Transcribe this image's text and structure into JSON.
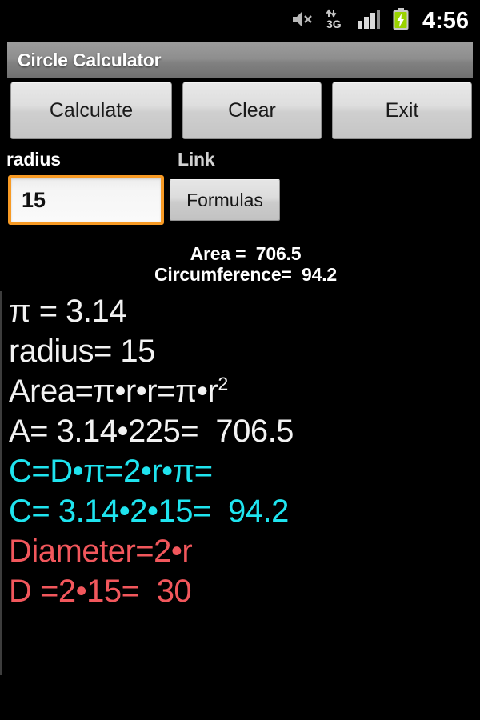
{
  "status_bar": {
    "icons": [
      "volume-mute-icon",
      "data-3g-icon",
      "signal-bars-icon",
      "battery-charging-icon"
    ],
    "time": "4:56"
  },
  "title_bar": {
    "title": "Circle Calculator"
  },
  "toolbar": {
    "calculate_label": "Calculate",
    "clear_label": "Clear",
    "exit_label": "Exit"
  },
  "form": {
    "radius_label": "radius",
    "radius_value": "15",
    "radius_placeholder": "radius",
    "link_label": "Link",
    "formulas_label": "Formulas"
  },
  "summary": {
    "area": "Area =  706.5",
    "circumference": "Circumference=  94.2"
  },
  "formulas": {
    "pi": "π = 3.14",
    "radius": "radius= 15",
    "area_formula_prefix": "Area=π•r•r=π•r",
    "area_formula_exponent": "2",
    "area_value": "A= 3.14•225=  706.5",
    "circumference_formula": "C=D•π=2•r•π=",
    "circumference_value": "C= 3.14•2•15=  94.2",
    "diameter_formula": "Diameter=2•r",
    "diameter_value": "D =2•15=  30"
  },
  "colors": {
    "background": "#000000",
    "white_text": "#f2f2f2",
    "cyan_text": "#1fe4ef",
    "red_text": "#f2575c",
    "focus_orange": "#f79a24",
    "battery_green": "#9ad300"
  }
}
